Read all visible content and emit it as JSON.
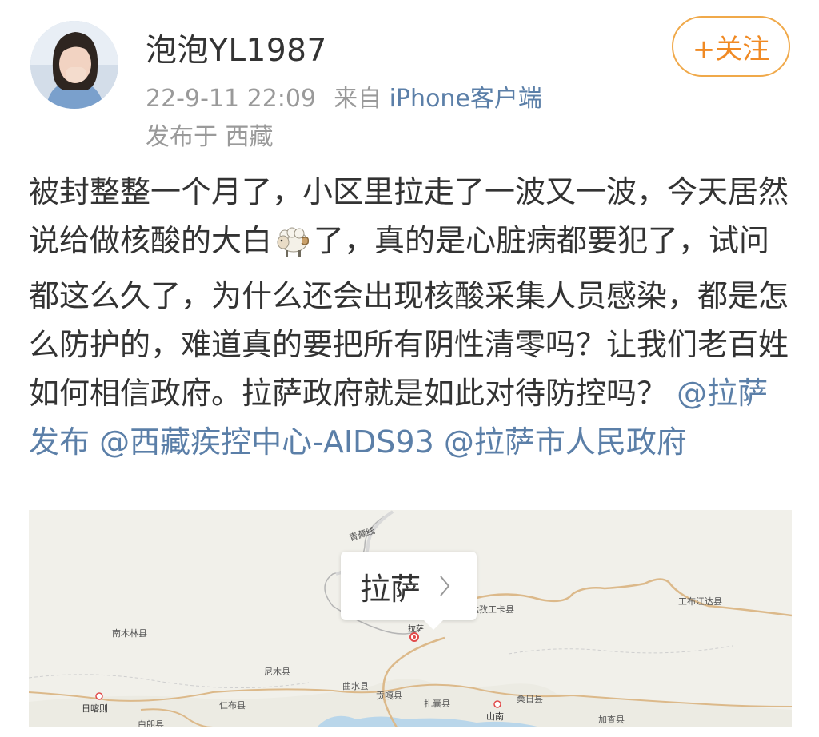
{
  "user": {
    "name": "泡泡YL1987",
    "timestamp": "22-9-11 22:09",
    "source_prefix": "来自",
    "source_client": "iPhone客户端",
    "location": "发布于 西藏",
    "follow_label": "+关注"
  },
  "post": {
    "text_before_emoji": "被封整整一个月了，小区里拉走了一波又一波，今天居然说给做核酸的大白",
    "text_after_emoji": "了，真的是心脏病都要犯了，试问都这么久了，为什么还会出现核酸采集人员感染，都是怎么防护的，难道真的要把所有阴性清零吗？让我们老百姓如何相信政府。拉萨政府就是如此对待防控吗？",
    "mentions": [
      "@拉萨发布",
      "@西藏疾控中心-AIDS93",
      "@拉萨市人民政府"
    ],
    "emoji": "sheep-emoji"
  },
  "map": {
    "callout_label": "拉萨",
    "labels": {
      "qingzang": "青藏线",
      "gongkar": "达孜工卡县",
      "gongbu": "工布江达县",
      "nanmulin": "南木林县",
      "lasa_pin": "拉萨",
      "nimu": "尼木县",
      "qushui": "曲水县",
      "gongga": "贡嘎县",
      "sangri": "桑日县",
      "rikaze": "日喀则",
      "renbu": "仁布县",
      "zhanang": "扎囊县",
      "shannan": "山南",
      "jiacha": "加查县",
      "bailang": "白朗县"
    }
  }
}
